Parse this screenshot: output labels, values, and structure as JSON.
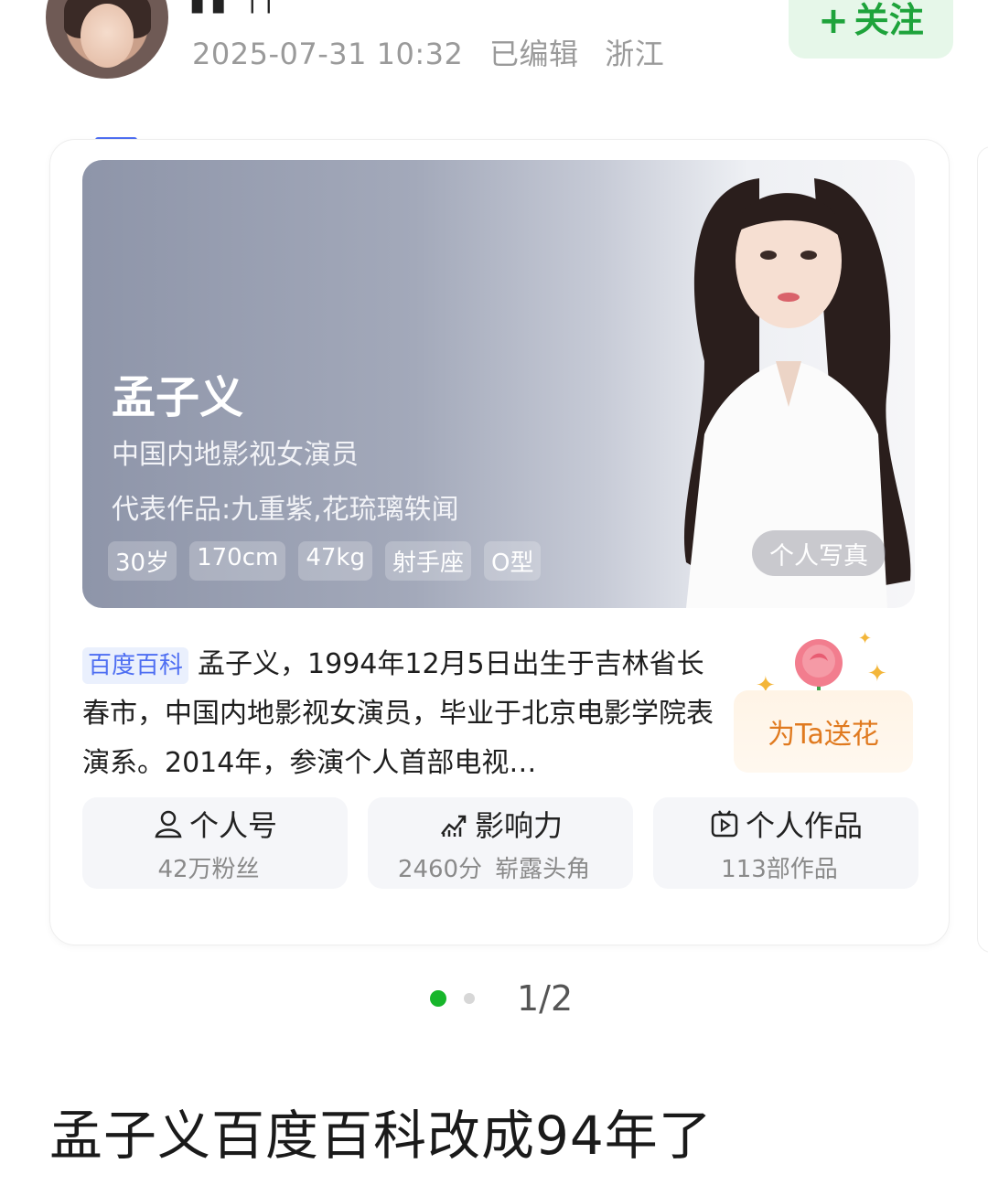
{
  "post": {
    "username": "▌▌ ││",
    "timestamp": "2025-07-31 10:32",
    "edited": "已编辑",
    "location": "浙江",
    "follow_label": "关注",
    "text": "孟子义百度百科改成94年了"
  },
  "card": {
    "name": "孟子义",
    "subtitle": "中国内地影视女演员",
    "works": "代表作品:九重紫,花琉璃轶闻",
    "tags": [
      "30岁",
      "170cm",
      "47kg",
      "射手座",
      "O型"
    ],
    "photo_button": "个人写真",
    "baike_tag": "百度百科",
    "description": "孟子义，1994年12月5日出生于吉林省长春市，中国内地影视女演员，毕业于北京电影学院表演系。2014年，参演个人首部电视…",
    "flower_button": "为Ta送花",
    "stats": [
      {
        "title": "个人号",
        "icon": "person-icon",
        "sub": [
          "42万粉丝"
        ]
      },
      {
        "title": "影响力",
        "icon": "trend-icon",
        "sub": [
          "2460分",
          "崭露头角"
        ]
      },
      {
        "title": "个人作品",
        "icon": "video-icon",
        "sub": [
          "113部作品"
        ]
      }
    ]
  },
  "pager": {
    "label": "1/2"
  },
  "colors": {
    "accent_green": "#17b62b",
    "baike_blue": "#4e6ef2",
    "flower_orange": "#e07a1f"
  }
}
